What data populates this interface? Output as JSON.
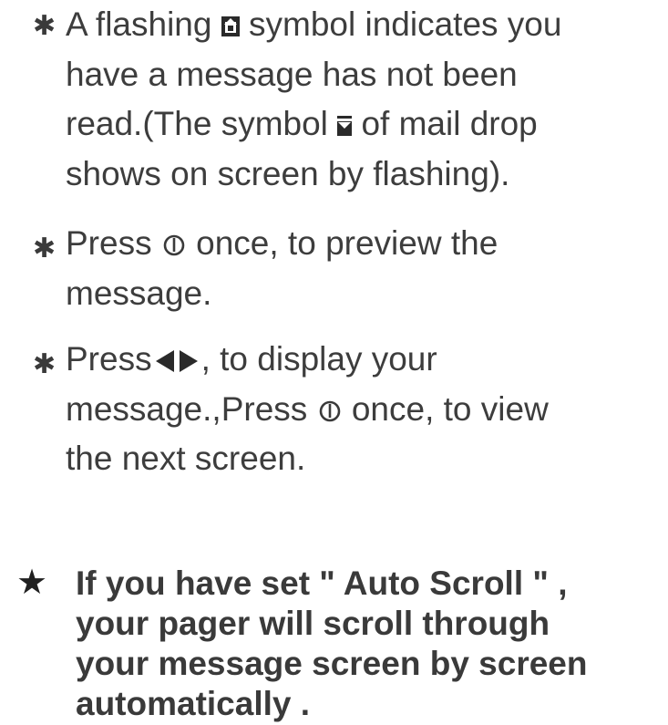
{
  "bullet_glyph": "✱",
  "star_glyph": "★",
  "icons": {
    "unread_message": "unread-message-icon",
    "mail_drop": "mail-drop-icon",
    "power_button": "power-button-icon",
    "left_right_arrows": "left-right-arrow-icons"
  },
  "bullets": [
    {
      "lines": [
        {
          "pre": "A flashing ",
          "post": " symbol indicates you"
        },
        {
          "text": "have a message has not been"
        },
        {
          "pre": "read.(The symbol ",
          "post": " of mail drop"
        },
        {
          "text": "shows on screen by flashing)."
        }
      ]
    },
    {
      "lines": [
        {
          "pre": "Press ",
          "post": " once, to preview the"
        },
        {
          "text": "message."
        }
      ]
    },
    {
      "lines": [
        {
          "pre": "Press",
          "post": ", to display your"
        },
        {
          "pre": "message.,Press ",
          "post": " once, to view"
        },
        {
          "text": "the next screen."
        }
      ]
    }
  ],
  "note": {
    "lines": [
      "If you have set \" Auto Scroll \" ,",
      "your pager will scroll through",
      "your message screen by screen",
      "automatically ."
    ]
  }
}
